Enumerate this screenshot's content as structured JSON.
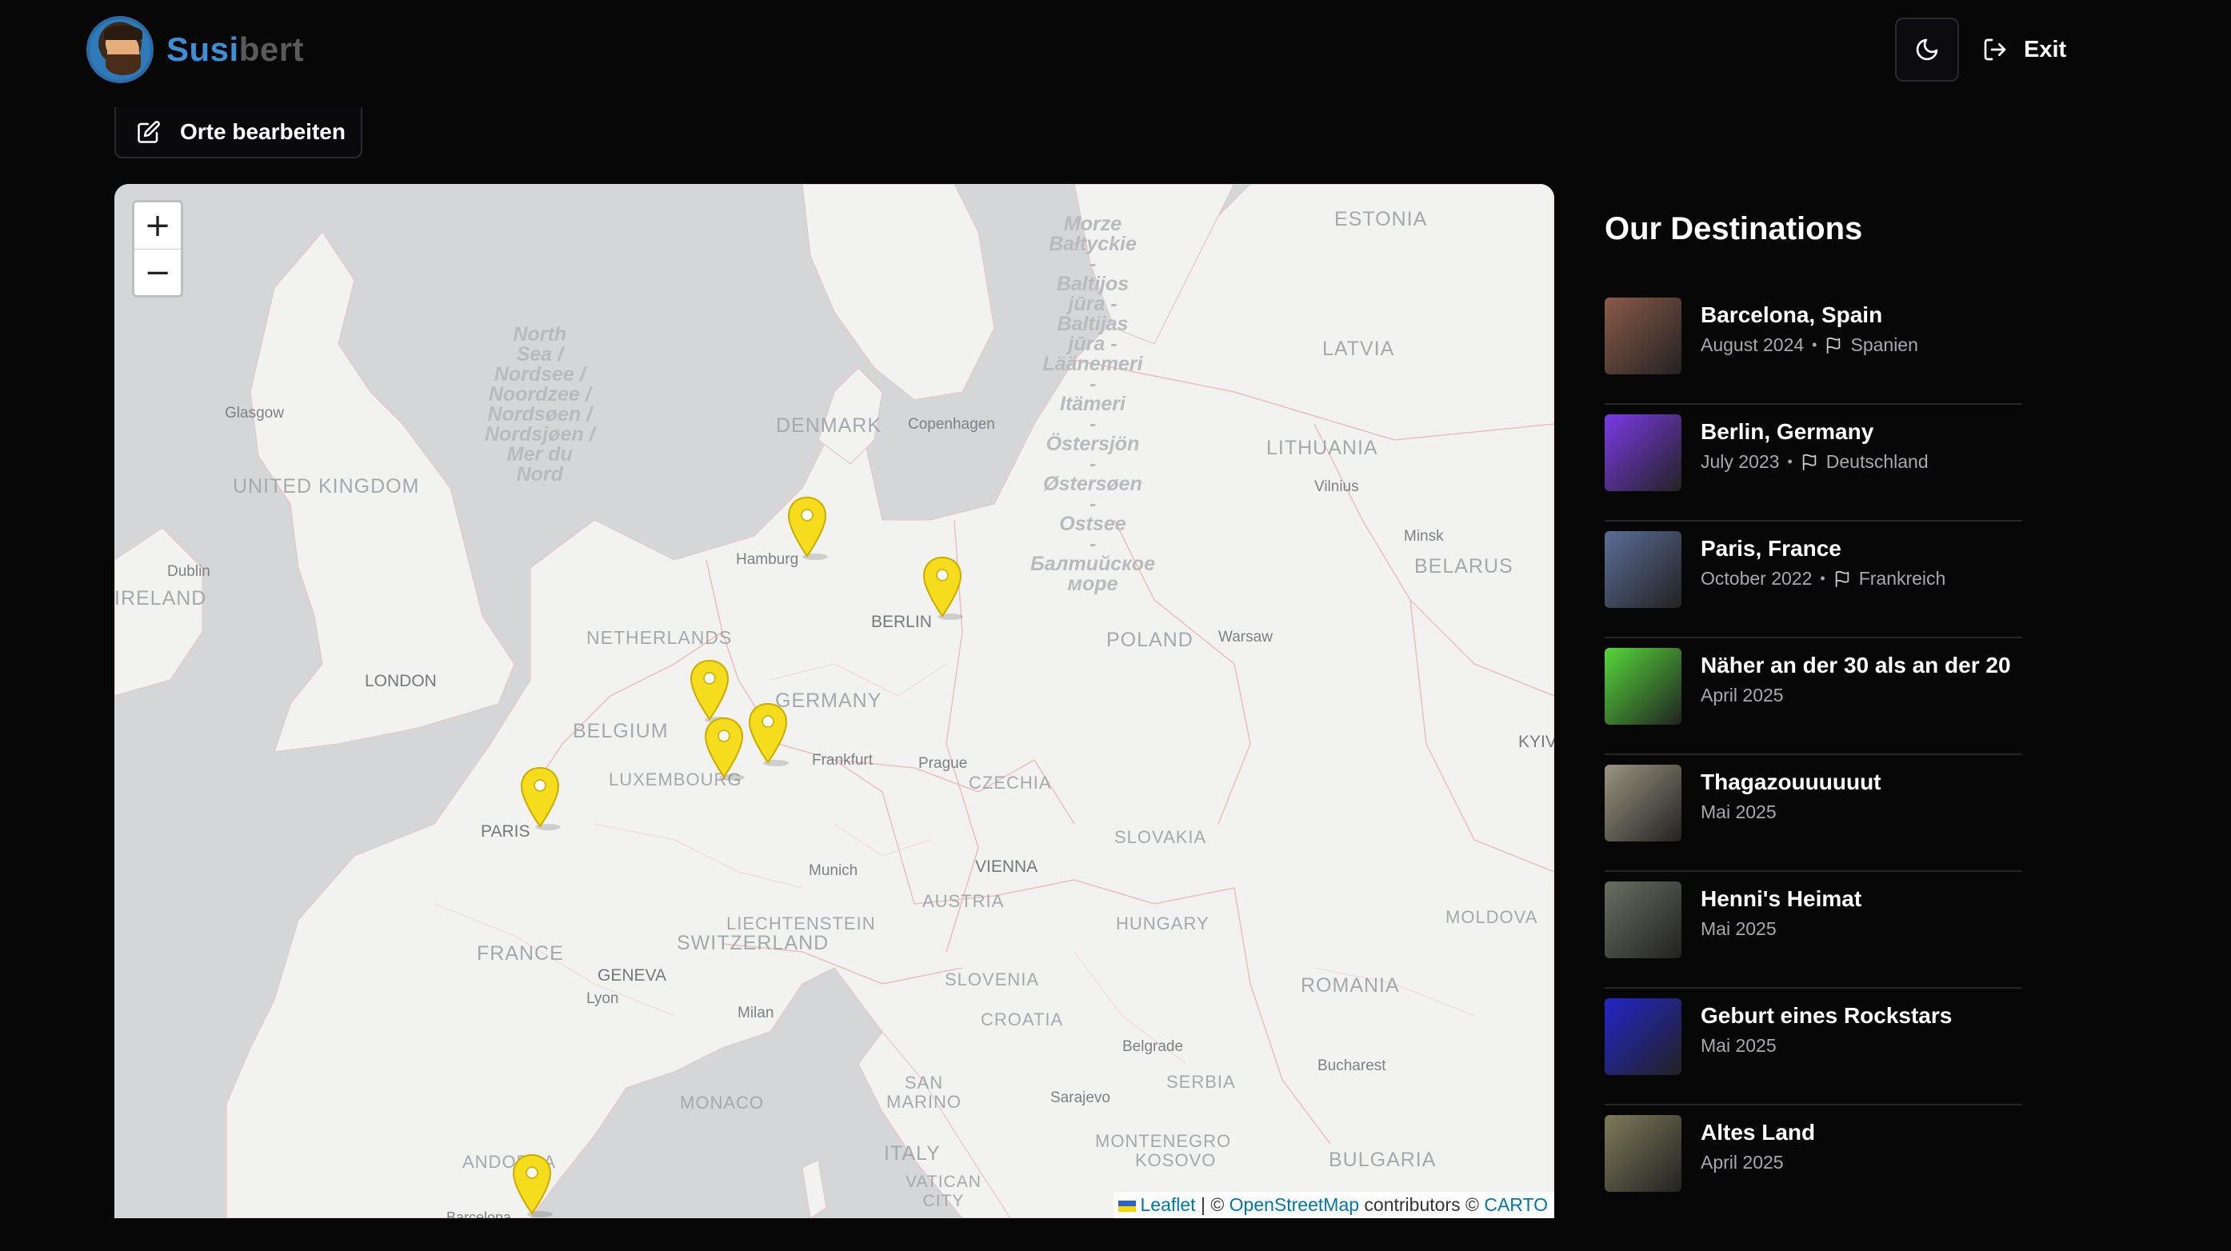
{
  "header": {
    "brand_prefix": "Susi",
    "brand_suffix": "bert",
    "exit_label": "Exit"
  },
  "toolbar": {
    "edit_places_label": "Orte bearbeiten"
  },
  "map": {
    "zoom_in": "+",
    "zoom_out": "−",
    "attribution": {
      "leaflet": "Leaflet",
      "sep": " | © ",
      "osm": "OpenStreetMap",
      "contributors": " contributors © ",
      "carto": "CARTO"
    },
    "labels": {
      "estonia": "ESTONIA",
      "latvia": "LATVIA",
      "lithuania": "LITHUANIA",
      "belarus": "BELARUS",
      "denmark": "DENMARK",
      "uk": "UNITED KINGDOM",
      "ireland": "IRELAND",
      "netherlands": "NETHERLANDS",
      "belgium": "BELGIUM",
      "luxembourg": "LUXEMBOURG",
      "germany": "GERMANY",
      "poland": "POLAND",
      "czechia": "CZECHIA",
      "slovakia": "SLOVAKIA",
      "austria": "AUSTRIA",
      "liechtenstein": "LIECHTENSTEIN",
      "switzerland": "SWITZERLAND",
      "france": "FRANCE",
      "hungary": "HUNGARY",
      "moldova": "MOLDOVA",
      "romania": "ROMANIA",
      "slovenia": "SLOVENIA",
      "croatia": "CROATIA",
      "serbia": "SERBIA",
      "monaco": "MONACO",
      "san_marino": "SAN\nMARINO",
      "italy": "ITALY",
      "vatican": "VATICAN\nCITY",
      "montenegro": "MONTENEGRO",
      "kosovo": "KOSOVO",
      "bulgaria": "BULGARIA",
      "andorra": "ANDORRA",
      "north_sea": "North\nSea /\nNordsee /\nNoordzee /\nNordsøen /\nNordsjøen /\nMer du\nNord",
      "baltic": "Morze\nBałtyckie\n-\nBaltijos\njūra -\nBaltijas\njūra -\nLäänemeri\n-\nItämeri\n-\nÖstersjön\n-\nØstersøen\n-\nOstsee\n-\nБалтийское\nморе",
      "glasgow": "Glasgow",
      "copenhagen": "Copenhagen",
      "vilnius": "Vilnius",
      "minsk": "Minsk",
      "dublin": "Dublin",
      "hamburg": "Hamburg",
      "berlin": "BERLIN",
      "warsaw": "Warsaw",
      "london": "LONDON",
      "frankfurt": "Frankfurt",
      "prague": "Prague",
      "paris": "PARIS",
      "munich": "Munich",
      "vienna": "VIENNA",
      "geneva": "GENEVA",
      "lyon": "Lyon",
      "milan": "Milan",
      "belgrade": "Belgrade",
      "bucharest": "Bucharest",
      "sarajevo": "Sarajevo",
      "kyiv": "KYIV",
      "barcelona": "Barcelona"
    }
  },
  "destinations": {
    "title": "Our Destinations",
    "items": [
      {
        "name": "Barcelona, Spain",
        "date": "August 2024",
        "country": "Spanien",
        "thumb": "#8a5a48"
      },
      {
        "name": "Berlin, Germany",
        "date": "July 2023",
        "country": "Deutschland",
        "thumb": "#7b3ae6"
      },
      {
        "name": "Paris, France",
        "date": "October 2022",
        "country": "Frankreich",
        "thumb": "#5b6d96"
      },
      {
        "name": "Näher an der 30 als an der 20",
        "date": "April 2025",
        "country": "",
        "thumb": "#55d63a"
      },
      {
        "name": "Thagazouuuuuut",
        "date": "Mai 2025",
        "country": "",
        "thumb": "#9a9580"
      },
      {
        "name": "Henni's Heimat",
        "date": "Mai 2025",
        "country": "",
        "thumb": "#6a6e62"
      },
      {
        "name": "Geburt eines Rockstars",
        "date": "Mai 2025",
        "country": "",
        "thumb": "#2325c8"
      },
      {
        "name": "Altes Land",
        "date": "April 2025",
        "country": "",
        "thumb": "#7e7a5a"
      }
    ]
  }
}
